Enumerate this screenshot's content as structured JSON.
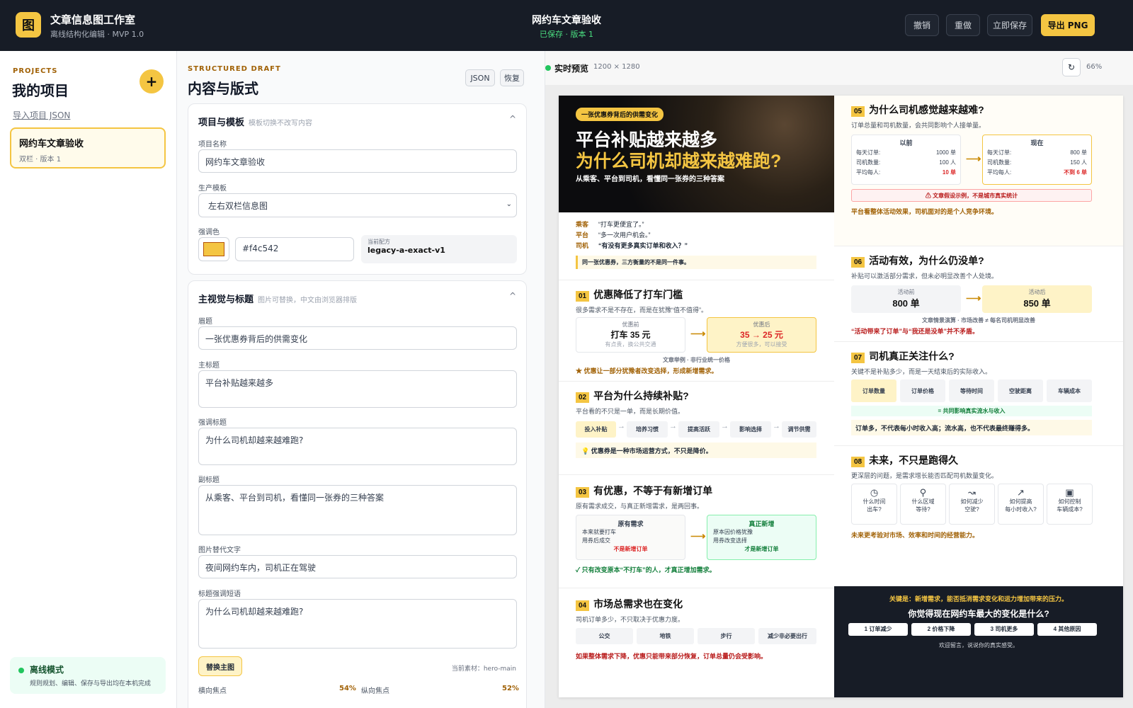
{
  "header": {
    "logo_glyph": "图",
    "app_title": "文章信息图工作室",
    "app_subtitle": "离线结构化编辑 · MVP 1.0",
    "doc_title": "网约车文章验收",
    "doc_status": "已保存 · 版本 1",
    "undo": "撤销",
    "redo": "重做",
    "save": "立即保存",
    "export": "导出 PNG"
  },
  "sidebar": {
    "eyebrow": "PROJECTS",
    "title": "我的项目",
    "add": "+",
    "import": "导入项目 JSON",
    "projects": [
      {
        "name": "网约车文章验收",
        "meta": "双栏 · 版本 1"
      }
    ],
    "offline_title": "离线模式",
    "offline_desc": "规则规划、编辑、保存与导出均在本机完成"
  },
  "editor": {
    "eyebrow": "STRUCTURED DRAFT",
    "title": "内容与版式",
    "json_btn": "JSON",
    "restore_btn": "恢复",
    "panel1": {
      "title": "项目与模板",
      "note": "模板切换不改写内容",
      "name_label": "项目名称",
      "name_value": "网约车文章验收",
      "template_label": "生产模板",
      "template_value": "左右双栏信息图",
      "accent_label": "强调色",
      "accent_value": "#f4c542",
      "recipe_label": "当前配方",
      "recipe_value": "legacy-a-exact-v1"
    },
    "panel2": {
      "title": "主视觉与标题",
      "note": "图片可替换，中文由浏览器排版",
      "eyebrow_label": "眉题",
      "eyebrow_value": "一张优惠券背后的供需变化",
      "title_label": "主标题",
      "title_value": "平台补贴越来越多",
      "accent_title_label": "强调标题",
      "accent_title_value": "为什么司机却越来越难跑?",
      "subtitle_label": "副标题",
      "subtitle_value": "从乘客、平台到司机，看懂同一张券的三种答案",
      "alt_label": "图片替代文字",
      "alt_value": "夜间网约车内，司机正在驾驶",
      "emph_label": "标题强调短语",
      "emph_value": "为什么司机却越来越难跑?",
      "replace_btn": "替换主图",
      "asset": "当前素材：hero-main",
      "fx_label": "横向焦点",
      "fx_value": "54%",
      "fy_label": "纵向焦点",
      "fy_value": "52%"
    }
  },
  "preview": {
    "label": "实时预览",
    "size": "1200 × 1280",
    "refresh": "↻",
    "zoom": "66%",
    "hero": {
      "eyebrow": "一张优惠券背后的供需变化",
      "title": "平台补贴越来越多",
      "accent": "为什么司机却越来越难跑?",
      "subtitle": "从乘客、平台到司机，看懂同一张券的三种答案"
    },
    "voices": [
      {
        "role": "乘客",
        "quote": "“打车更便宜了。”"
      },
      {
        "role": "平台",
        "quote": "“多一次用户机会。”"
      },
      {
        "role": "司机",
        "quote": "“有没有更多真实订单和收入？”"
      }
    ],
    "voices_note": "同一张优惠券，三方衡量的不是同一件事。",
    "s01": {
      "num": "01",
      "title": "优惠降低了打车门槛",
      "desc": "很多需求不是不存在，而是在犹豫“值不值得”。",
      "before_label": "优惠前",
      "before_value": "打车 35 元",
      "before_note": "有点贵，换公共交通",
      "after_label": "优惠后",
      "after_value": "35 → 25 元",
      "after_note": "方便很多，可以接受",
      "caption": "文章举例 · 非行业统一价格",
      "note": "★ 优惠让一部分犹豫者改变选择，形成新增需求。"
    },
    "s02": {
      "num": "02",
      "title": "平台为什么持续补贴?",
      "desc": "平台看的不只是一单，而是长期价值。",
      "steps": [
        "投入补贴",
        "培养习惯",
        "提高活跃",
        "影响选择",
        "调节供需"
      ],
      "note": "💡 优惠券是一种市场运营方式，不只是降价。"
    },
    "s03": {
      "num": "03",
      "title": "有优惠，不等于有新增订单",
      "desc": "原有需求成交，与真正新增需求，是两回事。",
      "left_title": "原有需求",
      "left_l1": "本来就要打车",
      "left_l2": "用券后成交",
      "left_tag": "不是新增订单",
      "right_title": "真正新增",
      "right_l1": "原本因价格犹豫",
      "right_l2": "用券改变选择",
      "right_tag": "才是新增订单",
      "note": "✓ 只有改变原本“不打车”的人，才真正增加需求。"
    },
    "s04": {
      "num": "04",
      "title": "市场总需求也在变化",
      "desc": "司机订单多少，不只取决于优惠力度。",
      "chips": [
        "公交",
        "地铁",
        "步行",
        "减少非必要出行"
      ],
      "note": "如果整体需求下降，优惠只能带来部分恢复，订单总量仍会受影响。"
    },
    "s05": {
      "num": "05",
      "title": "为什么司机感觉越来越难?",
      "desc": "订单总量和司机数量，会共同影响个人接单量。",
      "before_title": "以前",
      "now_title": "现在",
      "rows": [
        {
          "k": "每天订单:",
          "before": "1000 单",
          "now": "800 单"
        },
        {
          "k": "司机数量:",
          "before": "100 人",
          "now": "150 人"
        },
        {
          "k": "平均每人:",
          "before": "10 单",
          "now": "不到 6 单"
        }
      ],
      "warn": "⚠ 文章假设示例，不是城市真实统计",
      "note": "平台看整体活动效果，司机面对的是个人竞争环境。"
    },
    "s06": {
      "num": "06",
      "title": "活动有效，为什么仍没单?",
      "desc": "补贴可以激活部分需求，但未必明显改善个人处境。",
      "before_label": "活动前",
      "before_value": "800 单",
      "after_label": "活动后",
      "after_value": "850 单",
      "caption": "文章情景演算 · 市场改善 ≠ 每名司机明显改善",
      "note": "“活动带来了订单”与“我还是没单”并不矛盾。"
    },
    "s07": {
      "num": "07",
      "title": "司机真正关注什么?",
      "desc": "关键不是补贴多少，而是一天结束后的实际收入。",
      "chips": [
        "订单数量",
        "订单价格",
        "等待时间",
        "空驶距离",
        "车辆成本"
      ],
      "bar": "= 共同影响真实流水与收入",
      "note": "订单多，不代表每小时收入高；流水高，也不代表最终赚得多。"
    },
    "s08": {
      "num": "08",
      "title": "未来，不只是跑得久",
      "desc": "更深层的问题，是需求增长能否匹配司机数量变化。",
      "cards": [
        {
          "icon": "◷",
          "icon_name": "clock-icon",
          "l1": "什么时间",
          "l2": "出车?"
        },
        {
          "icon": "⚲",
          "icon_name": "location-icon",
          "l1": "什么区域",
          "l2": "等待?"
        },
        {
          "icon": "↝",
          "icon_name": "route-icon",
          "l1": "如何减少",
          "l2": "空驶?"
        },
        {
          "icon": "↗",
          "icon_name": "trend-up-icon",
          "l1": "如何提高",
          "l2": "每小时收入?"
        },
        {
          "icon": "▣",
          "icon_name": "wallet-icon",
          "l1": "如何控制",
          "l2": "车辆成本?"
        }
      ],
      "note": "未来更考验对市场、效率和时间的经营能力。"
    },
    "footer": {
      "lead": "关键是：新增需求，能否抵消需求变化和运力增加带来的压力。",
      "question": "你觉得现在网约车最大的变化是什么?",
      "options": [
        "1 订单减少",
        "2 价格下降",
        "3 司机更多",
        "4 其他原因"
      ],
      "cta": "欢迎留言，说说你的真实感受。"
    },
    "colors": {
      "accent": "#f4c542",
      "danger": "#dc2626",
      "ok": "#16a34a",
      "dark": "#171c26"
    }
  }
}
